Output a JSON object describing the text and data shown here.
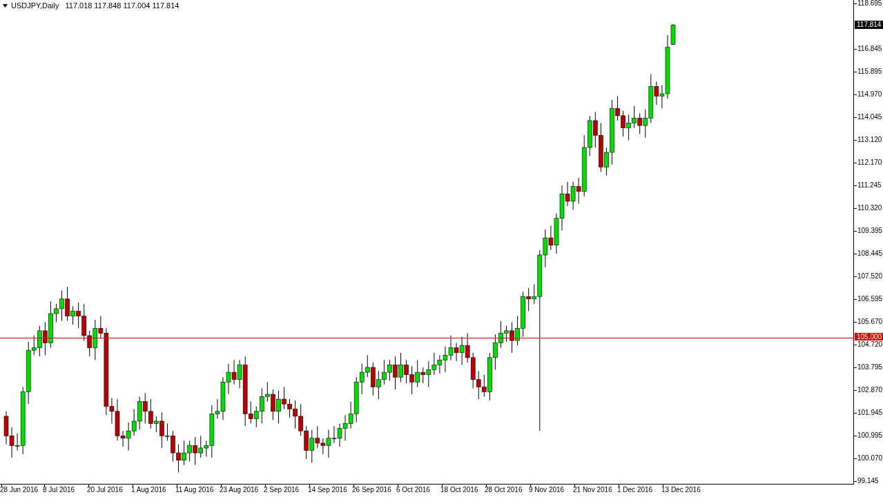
{
  "chart_header": {
    "symbol": "USDJPY,Daily",
    "open": "117.018",
    "high": "117.848",
    "low": "117.004",
    "close": "117.814"
  },
  "price_axis": {
    "labels": [
      "118.695",
      "116.845",
      "115.895",
      "114.970",
      "114.045",
      "113.120",
      "112.170",
      "111.245",
      "110.320",
      "109.395",
      "108.445",
      "107.520",
      "106.595",
      "105.670",
      "104.720",
      "103.795",
      "102.870",
      "101.945",
      "100.995",
      "100.070",
      "99.145"
    ],
    "current_price": "117.814",
    "level_line_label": "105.000"
  },
  "time_axis": {
    "labels": [
      "28 Jun 2016",
      "8 Jul 2016",
      "20 Jul 2016",
      "1 Aug 2016",
      "11 Aug 2016",
      "23 Aug 2016",
      "2 Sep 2016",
      "14 Sep 2016",
      "26 Sep 2016",
      "6 Oct 2016",
      "18 Oct 2016",
      "28 Oct 2016",
      "9 Nov 2016",
      "21 Nov 2016",
      "1 Dec 2016",
      "13 Dec 2016"
    ]
  }
}
